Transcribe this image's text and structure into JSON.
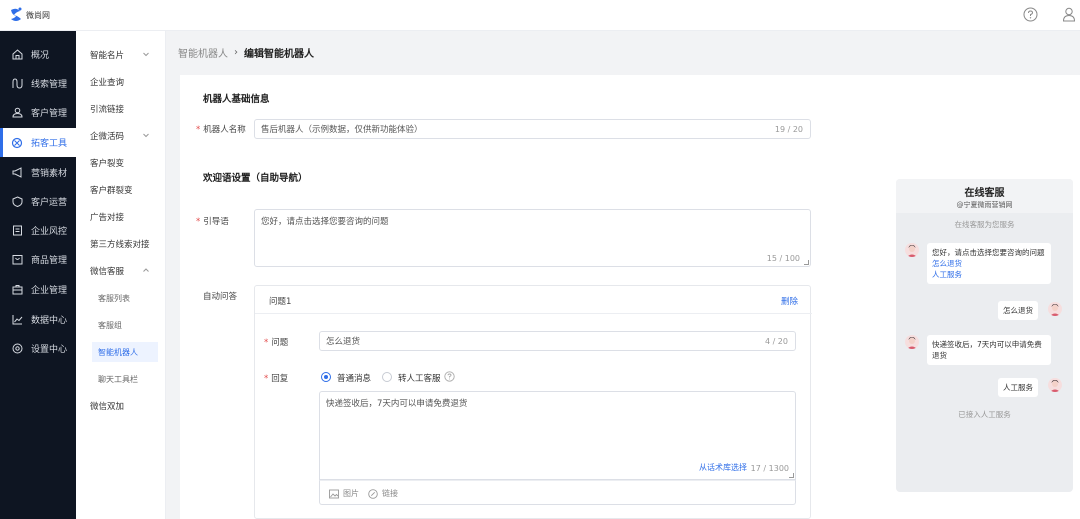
{
  "header": {
    "logo_text": "微尚网",
    "help_icon": "help-circle-icon",
    "user_icon": "user-icon"
  },
  "nav": {
    "items": [
      {
        "label": "概况",
        "icon": "home-icon"
      },
      {
        "label": "线索管理",
        "icon": "leads-icon"
      },
      {
        "label": "客户管理",
        "icon": "customers-icon"
      },
      {
        "label": "拓客工具",
        "icon": "tools-icon"
      },
      {
        "label": "营销素材",
        "icon": "megaphone-icon"
      },
      {
        "label": "客户运营",
        "icon": "shield-icon"
      },
      {
        "label": "企业风控",
        "icon": "document-icon"
      },
      {
        "label": "商品管理",
        "icon": "product-icon"
      },
      {
        "label": "企业管理",
        "icon": "briefcase-icon"
      },
      {
        "label": "数据中心",
        "icon": "chart-icon"
      },
      {
        "label": "设置中心",
        "icon": "settings-icon"
      }
    ],
    "active_index": 3
  },
  "subnav": {
    "items": [
      "智能名片",
      "企业查询",
      "引流链接",
      "企微活码",
      "客户裂变",
      "客户群裂变",
      "广告对接",
      "第三方线索对接",
      "微信客服"
    ],
    "children": [
      "客服列表",
      "客服组",
      "智能机器人",
      "聊天工具栏"
    ],
    "last": "微信双加",
    "active_child": "智能机器人"
  },
  "breadcrumb": {
    "parent": "智能机器人",
    "separator": "›",
    "current": "编辑智能机器人"
  },
  "form": {
    "basic_title": "机器人基础信息",
    "name_label": "机器人名称",
    "name_value": "售后机器人（示例数据，仅供新功能体验）",
    "name_count": "19 / 20",
    "welcome_title": "欢迎语设置（自助导航）",
    "guide_label": "引导语",
    "guide_value": "您好，请点击选择您要咨询的问题",
    "guide_count": "15 / 100",
    "auto_label": "自动问答",
    "qa": {
      "title": "问题1",
      "delete": "删除",
      "question_label": "问题",
      "question_value": "怎么退货",
      "question_count": "4 / 20",
      "reply_label": "回复",
      "reply_option_normal": "普通消息",
      "reply_option_human": "转人工客服",
      "reply_value": "快递签收后，7天内可以申请免费退货",
      "library_link": "从话术库选择",
      "reply_count": "17 / 1300",
      "image_label": "图片",
      "link_label": "链接"
    }
  },
  "preview": {
    "title": "在线客服",
    "subtitle": "@宁夏微雨营销网",
    "status_start": "在线客服为您服务",
    "bot_msg1": "您好，请点击选择您要咨询的问题",
    "bot_opt1": "怎么退货",
    "bot_opt2": "人工服务",
    "user_msg1": "怎么退货",
    "bot_msg2": "快递签收后，7天内可以申请免费退货",
    "user_msg2": "人工服务",
    "status_end": "已接入人工服务"
  },
  "colors": {
    "accent": "#2f6ee8",
    "nav_bg": "#0e1522",
    "required": "#e34d4d"
  }
}
